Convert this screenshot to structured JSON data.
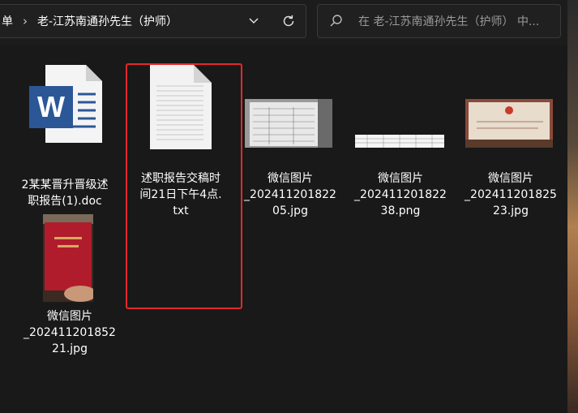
{
  "address_bar": {
    "crumb_prev": "单",
    "crumb_current": "老-江苏南通孙先生（护师）",
    "separator": "›"
  },
  "search": {
    "placeholder": "在 老-江苏南通孙先生（护师） 中..."
  },
  "files": [
    {
      "name_line1": "2某某晋升晋级述",
      "name_line2": "职报告(1).doc",
      "name_line3": "",
      "icon": "word-doc-icon"
    },
    {
      "name_line1": "述职报告交稿时",
      "name_line2": "间21日下午4点.",
      "name_line3": "txt",
      "icon": "text-file-icon"
    },
    {
      "name_line1": "微信图片",
      "name_line2": "_202411201822",
      "name_line3": "05.jpg",
      "icon": "image-thumbnail"
    },
    {
      "name_line1": "微信图片",
      "name_line2": "_202411201822",
      "name_line3": "38.png",
      "icon": "image-thumbnail"
    },
    {
      "name_line1": "微信图片",
      "name_line2": "_202411201825",
      "name_line3": "23.jpg",
      "icon": "image-thumbnail"
    },
    {
      "name_line1": "微信图片",
      "name_line2": "_202411201852",
      "name_line3": "21.jpg",
      "icon": "image-thumbnail"
    }
  ],
  "colors": {
    "background": "#191919",
    "highlight": "#e3282b",
    "word_blue": "#2b5797"
  }
}
